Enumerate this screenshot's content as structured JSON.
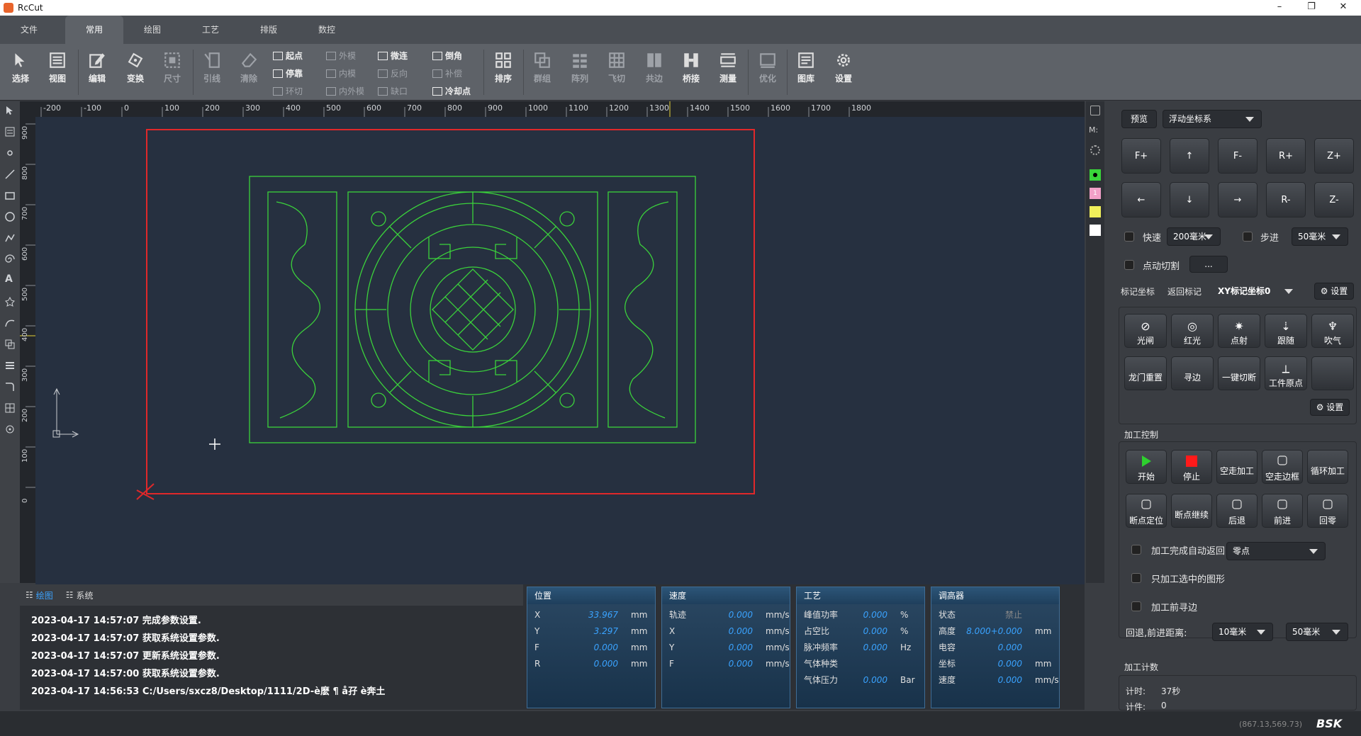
{
  "window": {
    "title": "RcCut",
    "controls": [
      "–",
      "❐",
      "✕"
    ]
  },
  "menu_tabs": [
    "文件",
    "常用",
    "绘图",
    "工艺",
    "排版",
    "数控"
  ],
  "ribbon": {
    "big_buttons": [
      {
        "label": "选择",
        "icon": "cursor-icon",
        "dim": false
      },
      {
        "label": "视图",
        "icon": "view-icon",
        "dim": false
      },
      {
        "label": "编辑",
        "icon": "edit-icon",
        "dim": false
      },
      {
        "label": "变换",
        "icon": "transform-icon",
        "dim": false
      },
      {
        "label": "尺寸",
        "icon": "size-icon",
        "dim": true
      },
      {
        "label": "引线",
        "icon": "leadline-icon",
        "dim": true
      },
      {
        "label": "清除",
        "icon": "eraser-icon",
        "dim": true
      }
    ],
    "small_buttons": [
      {
        "label": "起点",
        "dim": false
      },
      {
        "label": "停靠",
        "dim": false
      },
      {
        "label": "环切",
        "dim": true
      },
      {
        "label": "外模",
        "dim": true
      },
      {
        "label": "内模",
        "dim": true
      },
      {
        "label": "内外模",
        "dim": true
      },
      {
        "label": "微连",
        "dim": false
      },
      {
        "label": "反向",
        "dim": true
      },
      {
        "label": "缺口",
        "dim": true
      },
      {
        "label": "倒角",
        "dim": false
      },
      {
        "label": "补偿",
        "dim": true
      },
      {
        "label": "冷却点",
        "dim": false
      }
    ],
    "big_buttons_2": [
      {
        "label": "排序",
        "icon": "sort-icon",
        "dim": false
      },
      {
        "label": "群组",
        "icon": "group-icon",
        "dim": true
      },
      {
        "label": "阵列",
        "icon": "array-icon",
        "dim": true
      },
      {
        "label": "飞切",
        "icon": "flycut-icon",
        "dim": true
      },
      {
        "label": "共边",
        "icon": "common-edge-icon",
        "dim": true
      },
      {
        "label": "桥接",
        "icon": "bridge-icon",
        "dim": false
      },
      {
        "label": "测量",
        "icon": "measure-icon",
        "dim": false
      },
      {
        "label": "优化",
        "icon": "optimize-icon",
        "dim": true
      },
      {
        "label": "图库",
        "icon": "library-icon",
        "dim": false
      },
      {
        "label": "设置",
        "icon": "gear-icon",
        "dim": false
      }
    ]
  },
  "ruler_top": [
    "-200",
    "-100",
    "0",
    "100",
    "200",
    "300",
    "400",
    "500",
    "600",
    "700",
    "800",
    "900",
    "1000",
    "1100",
    "1200",
    "1300",
    "1400",
    "1500",
    "1600",
    "1700",
    "1800"
  ],
  "ruler_left": [
    "900",
    "800",
    "700",
    "600",
    "500",
    "400",
    "300",
    "200",
    "100",
    "0"
  ],
  "right_strip_layers": [
    "#39d63a",
    "#f2a0c8",
    "#f0ef5a",
    "#ffffff"
  ],
  "right_strip_labels": {
    "m": "M:",
    "layer_num": "1"
  },
  "panel": {
    "preview_label": "预览",
    "coord_system": "浮动坐标系",
    "jog_row1": [
      "F+",
      "↑",
      "F-",
      "R+",
      "Z+"
    ],
    "jog_row2": [
      "←",
      "↓",
      "→",
      "R-",
      "Z-"
    ],
    "fast_label": "快速",
    "fast_value": "200毫米",
    "step_label": "步进",
    "step_value": "50毫米",
    "jog_cut_label": "点动切割",
    "more_label": "...",
    "mark_label": "标记坐标",
    "return_mark_label": "返回标记",
    "mark_select": "XY标记坐标0",
    "settings_label": "设置",
    "func_row1": [
      {
        "label": "光闸",
        "icon": "shutter-icon",
        "glyph": "⊘"
      },
      {
        "label": "红光",
        "icon": "redlight-icon",
        "glyph": "◎"
      },
      {
        "label": "点射",
        "icon": "pulse-icon",
        "glyph": "✷"
      },
      {
        "label": "跟随",
        "icon": "follow-icon",
        "glyph": "⇣"
      },
      {
        "label": "吹气",
        "icon": "blow-icon",
        "glyph": "♆"
      }
    ],
    "func_row2": [
      {
        "label": "龙门重置",
        "icon": "",
        "glyph": ""
      },
      {
        "label": "寻边",
        "icon": "",
        "glyph": ""
      },
      {
        "label": "一键切断",
        "icon": "",
        "glyph": ""
      },
      {
        "label": "工件原点",
        "icon": "origin-icon",
        "glyph": "⟂"
      },
      {
        "label": "",
        "icon": "",
        "glyph": ""
      }
    ],
    "func_settings_label": "设置",
    "process_control_title": "加工控制",
    "proc_row1": [
      {
        "label": "开始",
        "icon": "play-icon"
      },
      {
        "label": "停止",
        "icon": "stop-icon"
      },
      {
        "label": "空走加工",
        "icon": ""
      },
      {
        "label": "空走边框",
        "icon": "frame-icon"
      },
      {
        "label": "循环加工",
        "icon": ""
      }
    ],
    "proc_row2": [
      {
        "label": "断点定位",
        "icon": "breakpoint-icon"
      },
      {
        "label": "断点继续",
        "icon": ""
      },
      {
        "label": "后退",
        "icon": "back-icon"
      },
      {
        "label": "前进",
        "icon": "forward-icon"
      },
      {
        "label": "回零",
        "icon": "home-icon"
      }
    ],
    "auto_return_label": "加工完成自动返回",
    "auto_return_value": "零点",
    "only_selected_label": "只加工选中的图形",
    "find_edge_label": "加工前寻边",
    "back_forward_label": "回退,前进距离:",
    "back_value": "10毫米",
    "forward_value": "50毫米",
    "count_title": "加工计数",
    "time_label": "计时:",
    "time_value": "37秒",
    "count_label": "计件:",
    "count_value": "0"
  },
  "log_tabs": {
    "draw": "绘图",
    "system": "系统"
  },
  "log_lines": [
    "2023-04-17 14:57:07 完成参数设置.",
    "2023-04-17 14:57:07 获取系统设置参数.",
    "2023-04-17 14:57:07 更新系统设置参数.",
    "2023-04-17 14:57:00 获取系统设置参数.",
    "2023-04-17 14:56:53 C:/Users/sxcz8/Desktop/1111/2D-è麽 ¶ å孖 è奔土"
  ],
  "status_boxes": [
    {
      "title": "位置",
      "rows": [
        {
          "k": "X",
          "v": "33.967",
          "u": "mm"
        },
        {
          "k": "Y",
          "v": "3.297",
          "u": "mm"
        },
        {
          "k": "F",
          "v": "0.000",
          "u": "mm"
        },
        {
          "k": "R",
          "v": "0.000",
          "u": "mm"
        }
      ]
    },
    {
      "title": "速度",
      "rows": [
        {
          "k": "轨迹",
          "v": "0.000",
          "u": "mm/s"
        },
        {
          "k": "X",
          "v": "0.000",
          "u": "mm/s"
        },
        {
          "k": "Y",
          "v": "0.000",
          "u": "mm/s"
        },
        {
          "k": "F",
          "v": "0.000",
          "u": "mm/s"
        }
      ]
    },
    {
      "title": "工艺",
      "rows": [
        {
          "k": "峰值功率",
          "v": "0.000",
          "u": "%"
        },
        {
          "k": "占空比",
          "v": "0.000",
          "u": "%"
        },
        {
          "k": "脉冲频率",
          "v": "0.000",
          "u": "Hz"
        },
        {
          "k": "气体种类",
          "v": "",
          "u": ""
        },
        {
          "k": "气体压力",
          "v": "0.000",
          "u": "Bar"
        }
      ]
    },
    {
      "title": "调高器",
      "rows": [
        {
          "k": "状态",
          "v": "禁止",
          "u": ""
        },
        {
          "k": "高度",
          "v": "8.000+0.000",
          "u": "mm"
        },
        {
          "k": "电容",
          "v": "0.000",
          "u": ""
        },
        {
          "k": "坐标",
          "v": "0.000",
          "u": "mm"
        },
        {
          "k": "速度",
          "v": "0.000",
          "u": "mm/s"
        }
      ]
    }
  ],
  "status_bar": {
    "coords": "(867.13,569.73)",
    "brand": "BSK"
  },
  "colors": {
    "accent_blue": "#3aa3ff",
    "outline_red": "#e0282a",
    "shape_green": "#3bd23b"
  }
}
